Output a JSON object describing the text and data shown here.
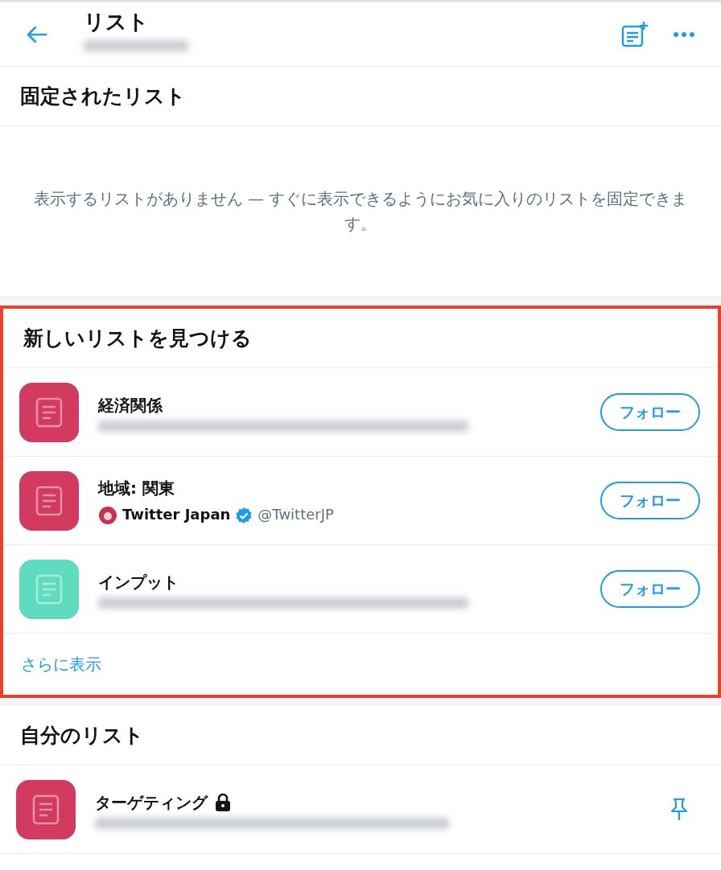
{
  "header": {
    "title": "リスト",
    "subtitle_blurred": true
  },
  "pinned": {
    "title": "固定されたリスト",
    "empty_message": "表示するリストがありません — すぐに表示できるようにお気に入りのリストを固定できます。"
  },
  "discover": {
    "title": "新しいリストを見つける",
    "highlighted": true,
    "lists": [
      {
        "name": "経済関係",
        "color": "#d23a5f",
        "owner": {
          "kind": "blurred"
        },
        "button": "フォロー"
      },
      {
        "name": "地域: 関東",
        "color": "#d23a5f",
        "owner": {
          "kind": "account",
          "name": "Twitter Japan",
          "verified": true,
          "handle": "@TwitterJP"
        },
        "button": "フォロー"
      },
      {
        "name": "インプット",
        "color": "#5fdbbf",
        "owner": {
          "kind": "blurred"
        },
        "button": "フォロー"
      }
    ],
    "more": "さらに表示"
  },
  "mine": {
    "title": "自分のリスト",
    "lists": [
      {
        "name": "ターゲティング",
        "color": "#d23a5f",
        "private": true,
        "owner": {
          "kind": "blurred"
        }
      }
    ]
  }
}
